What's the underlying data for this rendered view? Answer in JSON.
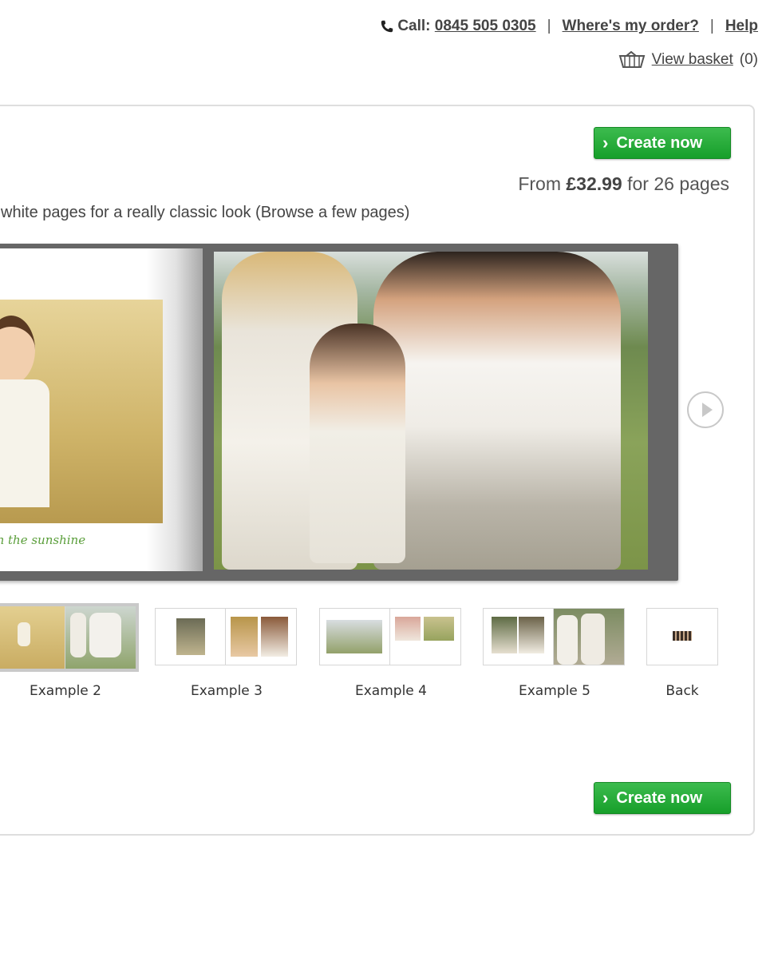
{
  "header": {
    "call_label": "Call:",
    "phone": "0845 505 0305",
    "where_order": "Where's my order?",
    "help": "Help",
    "separator": "|",
    "view_basket": "View basket",
    "basket_count": "(0)"
  },
  "product": {
    "create_label": "Create now",
    "price_prefix": "From",
    "price": "£32.99",
    "price_suffix": "for 26 pages",
    "description": "white pages for a really classic look",
    "browse_link": "(Browse a few pages)",
    "left_page_caption": "t in the sunshine"
  },
  "thumbnails": [
    {
      "label": "Example 2",
      "active": true
    },
    {
      "label": "Example 3",
      "active": false
    },
    {
      "label": "Example 4",
      "active": false
    },
    {
      "label": "Example 5",
      "active": false
    },
    {
      "label": "Back",
      "active": false
    }
  ],
  "colors": {
    "button_green": "#23a934",
    "border_grey": "#dedede",
    "caption_green": "#5a9e3a"
  },
  "icons": {
    "phone": "phone-icon",
    "basket": "basket-icon",
    "next": "arrow-right-icon"
  }
}
